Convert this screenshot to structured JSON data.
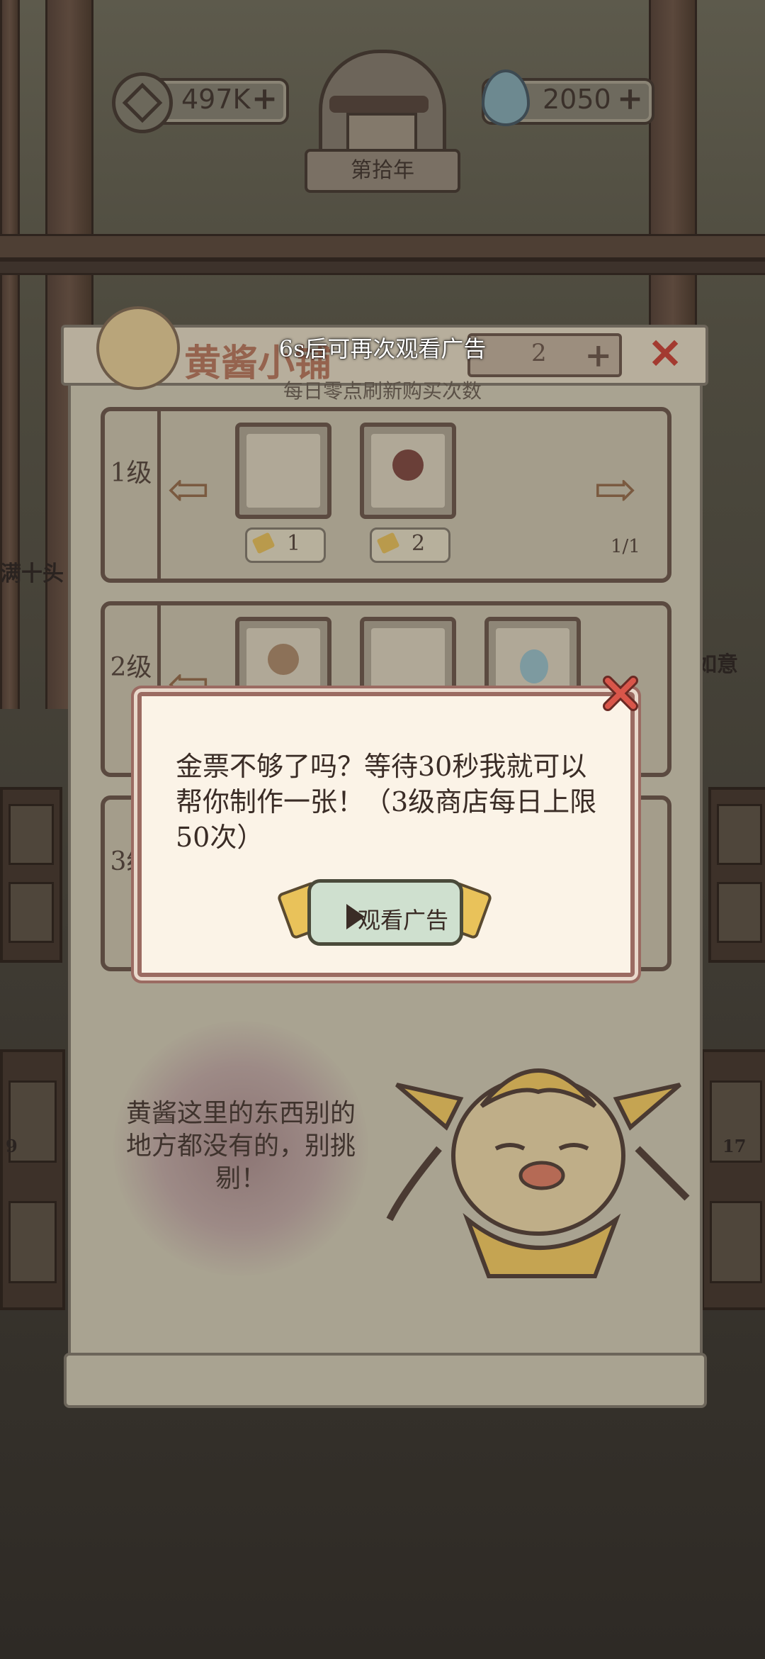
{
  "hud": {
    "coins": "497K",
    "gems": "2050",
    "year": "第拾年"
  },
  "side_labels": {
    "left": "满十头",
    "right": "如意",
    "left_count": "9",
    "right_count": "17"
  },
  "shop": {
    "title": "黄酱小铺",
    "subtitle": "每日零点刷新购买次数",
    "toast": "6s后可再次观看广告",
    "purchase_count": "2",
    "tiers": [
      {
        "level_label": "1级",
        "items": [
          {
            "name": "paper-packet",
            "price": "1"
          },
          {
            "name": "red-bead-plate",
            "price": "2"
          }
        ],
        "page": "1/1"
      },
      {
        "level_label": "2级",
        "items": [
          {
            "name": "orb-plate"
          },
          {
            "name": "spring-coil"
          },
          {
            "name": "blue-spirit"
          }
        ]
      },
      {
        "level_label": "3级",
        "items": []
      }
    ],
    "speech": "黄酱这里的东西别的地方都没有的，别挑剔！"
  },
  "dialog": {
    "message": "金票不够了吗？等待30秒我就可以帮你制作一张！（3级商店每日上限50次）",
    "watch_ad_label": "观看广告"
  },
  "colors": {
    "dialog_bg": "#fbf3e7",
    "dialog_border": "#9b6b62",
    "close_red": "#c8463c",
    "button_green": "#cfe0cf"
  }
}
